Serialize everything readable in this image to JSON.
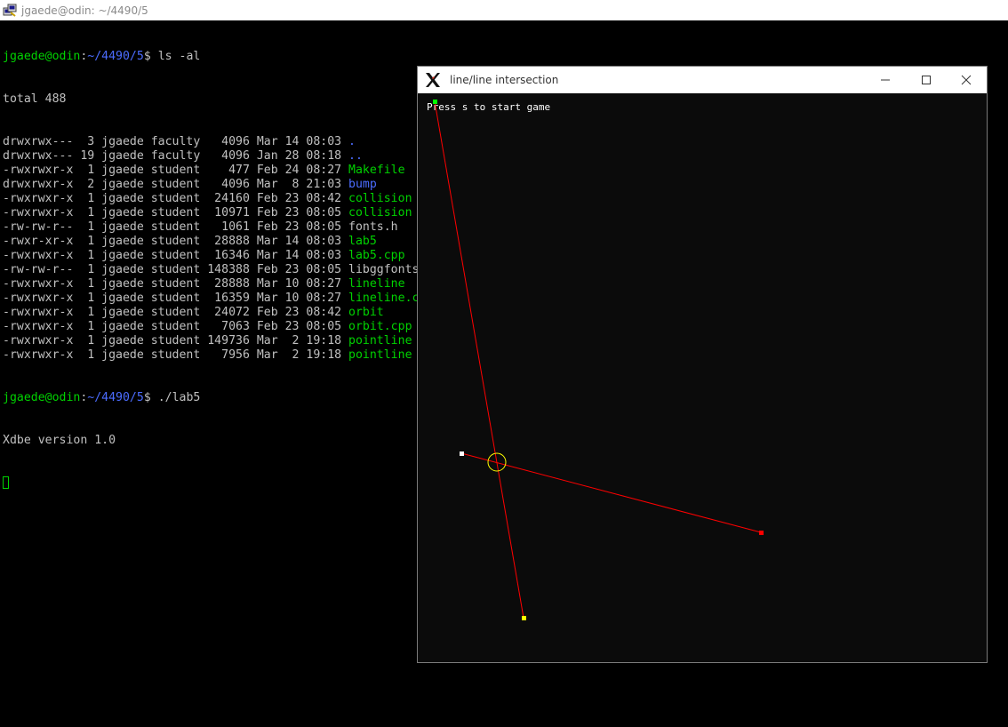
{
  "terminal_window": {
    "title": "jgaede@odin: ~/4490/5",
    "icon": "putty-icon"
  },
  "terminal": {
    "prompt_user_host": "jgaede@odin",
    "prompt_path": "~/4490/5",
    "command1": "ls -al",
    "total_line": "total 488",
    "listing": [
      {
        "meta": "drwxrwx---  3 jgaede faculty   4096 Mar 14 08:03 ",
        "name": ".",
        "color": "blue"
      },
      {
        "meta": "drwxrwx--- 19 jgaede faculty   4096 Jan 28 08:18 ",
        "name": "..",
        "color": "blue"
      },
      {
        "meta": "-rwxrwxr-x  1 jgaede student    477 Feb 24 08:27 ",
        "name": "Makefile",
        "color": "green"
      },
      {
        "meta": "drwxrwxr-x  2 jgaede student   4096 Mar  8 21:03 ",
        "name": "bump",
        "color": "blue"
      },
      {
        "meta": "-rwxrwxr-x  1 jgaede student  24160 Feb 23 08:42 ",
        "name": "collision",
        "color": "green"
      },
      {
        "meta": "-rwxrwxr-x  1 jgaede student  10971 Feb 23 08:05 ",
        "name": "collision",
        "color": "green"
      },
      {
        "meta": "-rw-rw-r--  1 jgaede student   1061 Feb 23 08:05 ",
        "name": "fonts.h",
        "color": "white"
      },
      {
        "meta": "-rwxr-xr-x  1 jgaede student  28888 Mar 14 08:03 ",
        "name": "lab5",
        "color": "green"
      },
      {
        "meta": "-rwxrwxr-x  1 jgaede student  16346 Mar 14 08:03 ",
        "name": "lab5.cpp",
        "color": "green"
      },
      {
        "meta": "-rw-rw-r--  1 jgaede student 148388 Feb 23 08:05 ",
        "name": "libggfonts",
        "color": "white"
      },
      {
        "meta": "-rwxrwxr-x  1 jgaede student  28888 Mar 10 08:27 ",
        "name": "lineline",
        "color": "green"
      },
      {
        "meta": "-rwxrwxr-x  1 jgaede student  16359 Mar 10 08:27 ",
        "name": "lineline.c",
        "color": "green"
      },
      {
        "meta": "-rwxrwxr-x  1 jgaede student  24072 Feb 23 08:42 ",
        "name": "orbit",
        "color": "green"
      },
      {
        "meta": "-rwxrwxr-x  1 jgaede student   7063 Feb 23 08:05 ",
        "name": "orbit.cpp",
        "color": "green"
      },
      {
        "meta": "-rwxrwxr-x  1 jgaede student 149736 Mar  2 19:18 ",
        "name": "pointline",
        "color": "green"
      },
      {
        "meta": "-rwxrwxr-x  1 jgaede student   7956 Mar  2 19:18 ",
        "name": "pointline",
        "color": "green"
      }
    ],
    "command2": "./lab5",
    "output_line": "Xdbe version 1.0"
  },
  "x_window": {
    "title": "line/line intersection",
    "icon": "x11-logo-icon",
    "message": "Press s to start game",
    "buttons": {
      "minimize": "minimize-icon",
      "maximize": "maximize-icon",
      "close": "close-icon"
    }
  },
  "colors": {
    "terminal_green": "#00d200",
    "terminal_blue": "#4b6cff",
    "terminal_text": "#c0c0c0",
    "line_color": "#ff0000",
    "intersection_circle": "#ffff00",
    "endpoint_green": "#00ff00",
    "endpoint_white": "#ffffff",
    "endpoint_red": "#ff0000",
    "endpoint_yellow": "#ffff00"
  }
}
